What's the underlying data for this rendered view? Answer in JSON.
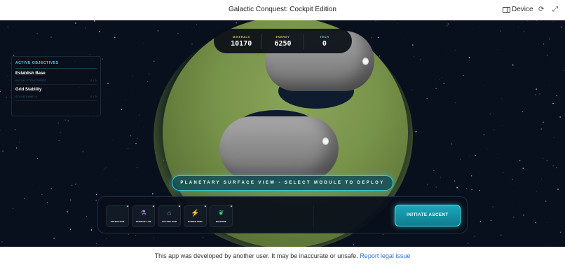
{
  "app": {
    "title": "Galactic Conquest: Cockpit Edition",
    "device_label": "Device"
  },
  "resources": [
    {
      "label": "MINERALS",
      "value": "10170",
      "color": "#e8c75a"
    },
    {
      "label": "ENERGY",
      "value": "6250",
      "color": "#e8c75a"
    },
    {
      "label": "TECH",
      "value": "0",
      "color": "#7fd6e8"
    }
  ],
  "objectives": {
    "heading": "ACTIVE OBJECTIVES",
    "items": [
      {
        "name": "Establish Base",
        "task": "INITIAL STRUCTURES",
        "progress": "0 / 3"
      },
      {
        "name": "Grid Stability",
        "task": "SOLAR PANELS",
        "progress": "0 / 3"
      }
    ]
  },
  "banner": "PLANETARY SURFACE VIEW - SELECT MODULE TO DEPLOY",
  "modules": [
    {
      "label": "EXTRACTOR",
      "icon": "extractor-icon",
      "badge": "■",
      "color": "#9aa3ad"
    },
    {
      "label": "SCIENCE LAB",
      "icon": "flask-icon",
      "badge": "■",
      "color": "#b37cf0"
    },
    {
      "label": "COLONY POD",
      "icon": "house-icon",
      "badge": "■",
      "color": "#4fa3f5"
    },
    {
      "label": "POWER GRID",
      "icon": "lightning-icon",
      "badge": "■",
      "color": "#39d0e6"
    },
    {
      "label": "BIODOME",
      "icon": "leaf-icon",
      "badge": "■",
      "color": "#3fd06b"
    }
  ],
  "action_button": "INITIATE ASCENT",
  "footer": {
    "notice": "This app was developed by another user. It may be inaccurate or unsafe.",
    "link": "Report legal issue"
  }
}
